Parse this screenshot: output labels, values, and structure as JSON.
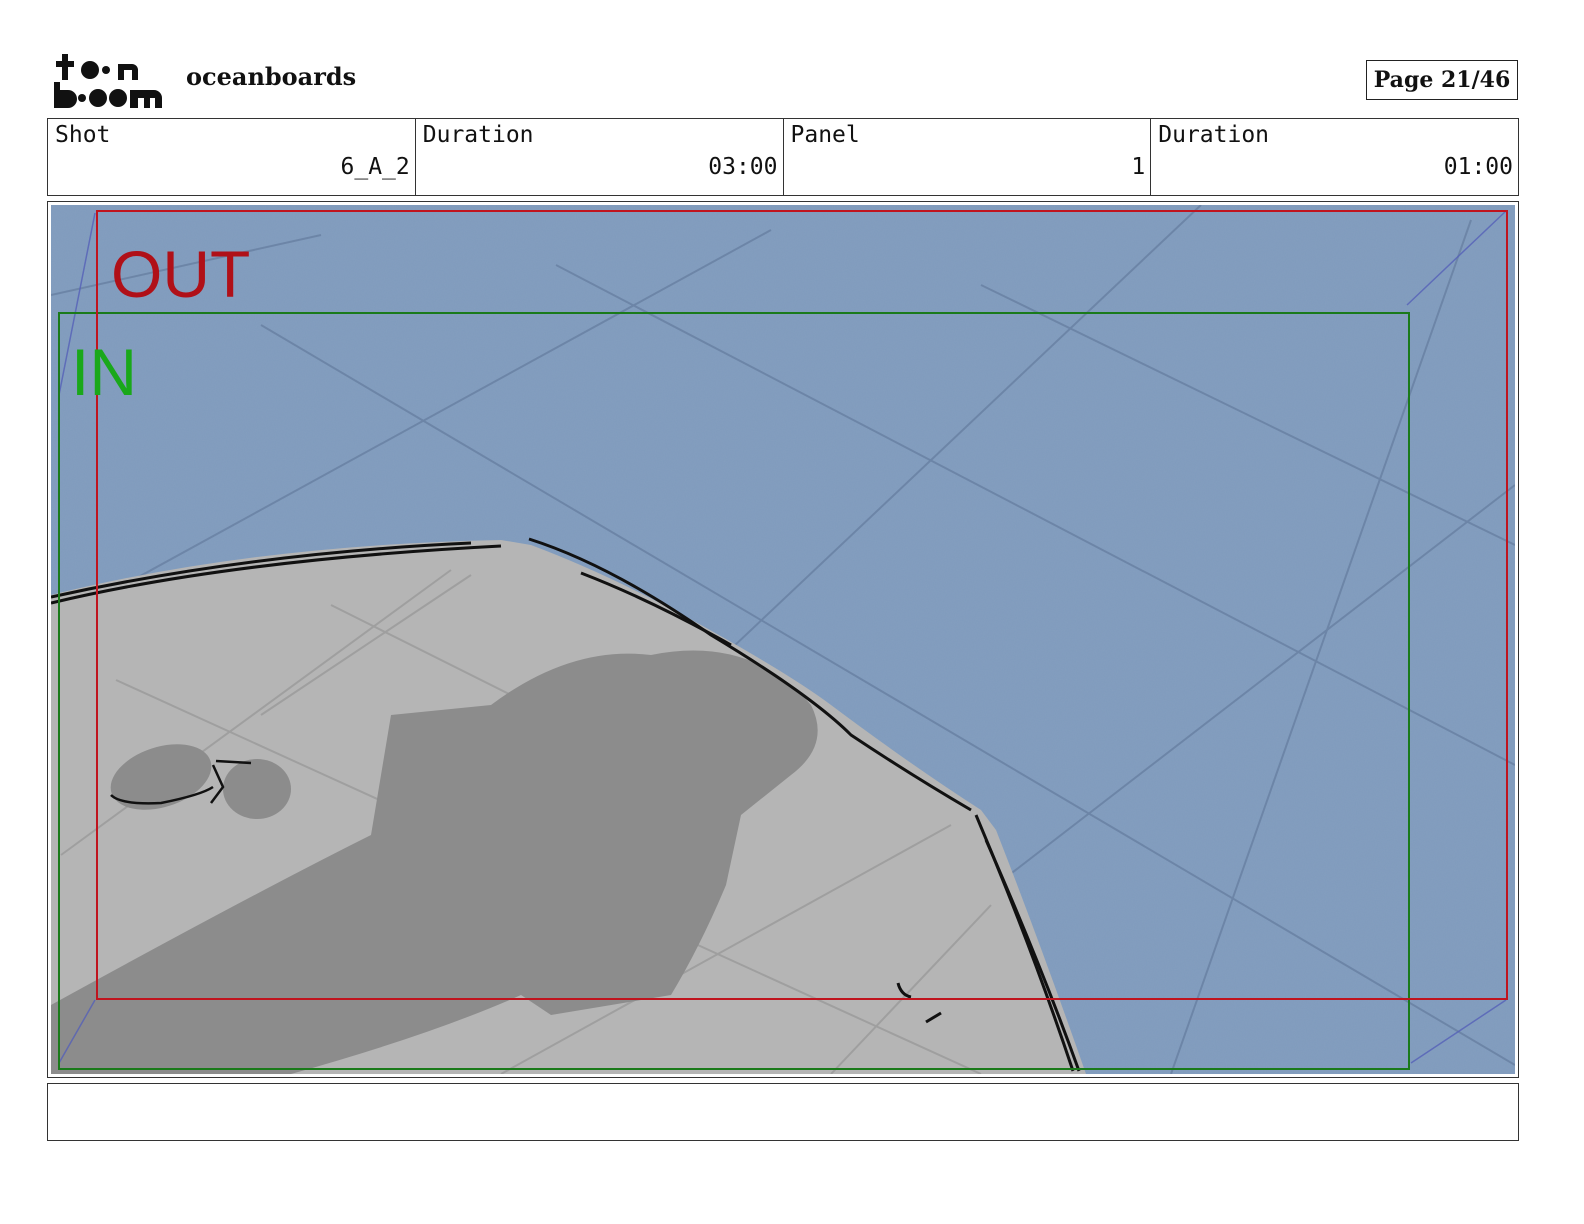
{
  "brand": {
    "logo_line1": "toon",
    "logo_line2": "boom",
    "logo_icon": "toon-boom-logo"
  },
  "project": {
    "title": "oceanboards"
  },
  "page": {
    "label": "Page 21/46"
  },
  "shot": {
    "label": "Shot",
    "value": "6_A_2",
    "duration_label": "Duration",
    "duration": "03:00"
  },
  "panel": {
    "label": "Panel",
    "value": "1",
    "duration_label": "Duration",
    "duration": "01:00"
  },
  "frames": {
    "out_label": "OUT",
    "out_color": "#c0141e",
    "in_label": "IN",
    "in_color": "#1a8c1a"
  },
  "colors": {
    "water": "#7f9bbd",
    "boat_deck": "#b5b5b5",
    "shadow": "#8c8c8c"
  },
  "notes": {
    "text": ""
  }
}
